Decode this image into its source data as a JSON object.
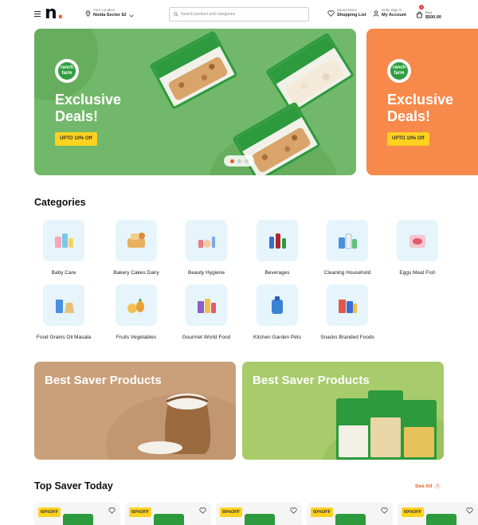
{
  "header": {
    "logo": "n",
    "location_caption": "Your Location",
    "location_value": "Noida Sector 62",
    "search_placeholder": "Search product and categories",
    "saved_caption": "Saved Items",
    "saved_label": "Shopping List",
    "account_caption": "Hello Sign In",
    "account_label": "My Account",
    "bag_caption": "Bag",
    "bag_total": "$500.00",
    "bag_count": "2"
  },
  "banners": [
    {
      "brand": "ranch farm",
      "title": "Exclusive Deals!",
      "offer": "UPTO 10% Off"
    },
    {
      "brand": "ranch farm",
      "title": "Exclusive Deals!",
      "offer": "UPTO 10% Off"
    }
  ],
  "categories": {
    "title": "Categories",
    "items": [
      {
        "label": "Baby Care",
        "icon": "baby-care-icon"
      },
      {
        "label": "Bakery Cakes Dairy",
        "icon": "bakery-icon"
      },
      {
        "label": "Beauty Hygiene",
        "icon": "beauty-icon"
      },
      {
        "label": "Beverages",
        "icon": "beverages-icon"
      },
      {
        "label": "Cleaning Household",
        "icon": "cleaning-icon"
      },
      {
        "label": "Eggs Meat Fish",
        "icon": "eggs-meat-icon"
      },
      {
        "label": "Food Grains Oil Masala",
        "icon": "grains-icon"
      },
      {
        "label": "Fruits Vegetables",
        "icon": "fruits-icon"
      },
      {
        "label": "Gourmet World Food",
        "icon": "gourmet-icon"
      },
      {
        "label": "Kitchen Garden Pets",
        "icon": "kitchen-icon"
      },
      {
        "label": "Snacks Branded Foods",
        "icon": "snacks-icon"
      }
    ]
  },
  "saver_banners": [
    {
      "title": "Best Saver Products"
    },
    {
      "title": "Best Saver Products"
    }
  ],
  "top_saver": {
    "title": "Top Saver Today",
    "see_all": "See All",
    "cards": [
      {
        "discount": "60%OFF"
      },
      {
        "discount": "60%OFF"
      },
      {
        "discount": "60%OFF"
      },
      {
        "discount": "60%OFF"
      },
      {
        "discount": "60%OFF"
      }
    ]
  },
  "colors": {
    "accent": "#f15a29",
    "banner_green": "#72b86a",
    "banner_orange": "#f7894a",
    "offer_yellow": "#ffd21f",
    "tile_blue": "#e6f4fb",
    "saver_tan": "#caa07a",
    "saver_lime": "#a8cc6c"
  }
}
